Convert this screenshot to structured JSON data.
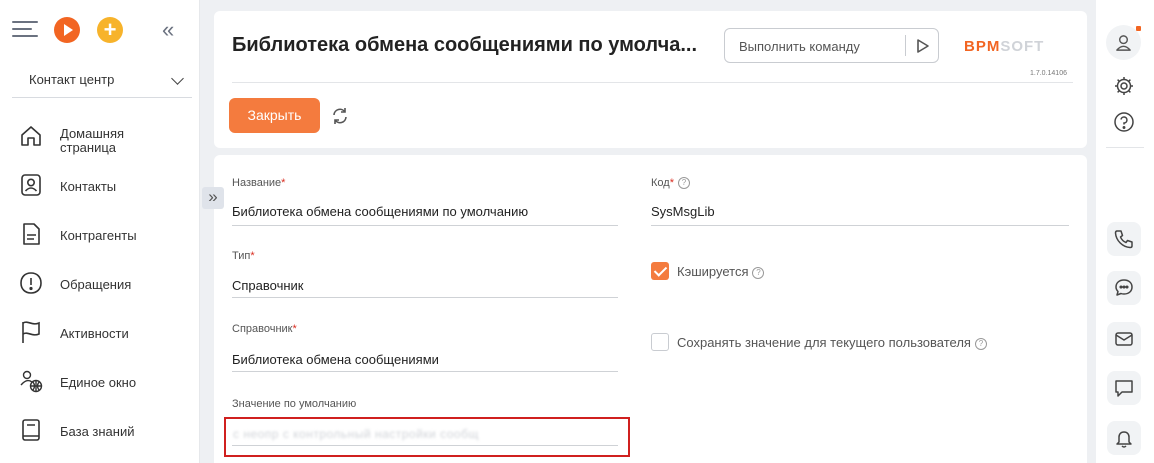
{
  "sidebar": {
    "workspace": "Контакт центр",
    "items": [
      {
        "icon": "home-icon",
        "label": "Домашняя страница"
      },
      {
        "icon": "contacts-icon",
        "label": "Контакты"
      },
      {
        "icon": "accounts-icon",
        "label": "Контрагенты"
      },
      {
        "icon": "cases-icon",
        "label": "Обращения"
      },
      {
        "icon": "activities-icon",
        "label": "Активности"
      },
      {
        "icon": "single-window-icon",
        "label": "Единое окно"
      },
      {
        "icon": "knowledge-base-icon",
        "label": "База знаний"
      }
    ]
  },
  "header": {
    "title": "Библиотека обмена сообщениями по умолча...",
    "command_placeholder": "Выполнить команду",
    "logo_part1": "BPM",
    "logo_part2": "SOFT",
    "version": "1.7.0.14106",
    "close_label": "Закрыть"
  },
  "form": {
    "name": {
      "label": "Название",
      "value": "Библиотека обмена сообщениями по умолчанию"
    },
    "code": {
      "label": "Код",
      "value": "SysMsgLib"
    },
    "type": {
      "label": "Тип",
      "value": "Справочник"
    },
    "lookup": {
      "label": "Справочник",
      "value": "Библиотека обмена сообщениями"
    },
    "default_value": {
      "label": "Значение по умолчанию",
      "value": "с неопр с контрольный настройки сообщ"
    },
    "cached": {
      "label": "Кэшируется",
      "checked": true
    },
    "save_for_user": {
      "label": "Сохранять значение для текущего пользователя",
      "checked": false
    },
    "required_mark": "*",
    "help_mark": "?"
  },
  "colors": {
    "accent": "#f47b3e",
    "highlight_border": "#d0201f"
  }
}
